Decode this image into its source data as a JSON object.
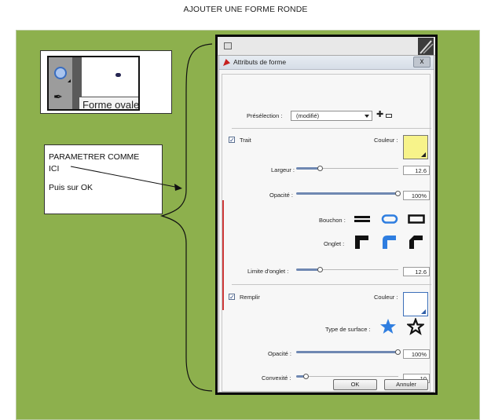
{
  "page": {
    "title": "AJOUTER UNE FORME RONDE"
  },
  "thumbnail": {
    "tooltip": "Forme ovale"
  },
  "note": {
    "line1": "PARAMETRER COMME",
    "line2": "ICI",
    "line3": "Puis sur OK"
  },
  "dialog": {
    "title": "Attributs de forme",
    "close_label": "x",
    "preset": {
      "label": "Présélection :",
      "value": "(modifié)",
      "add_icon": "plus-icon",
      "remove_icon": "minus-icon"
    },
    "stroke": {
      "label": "Trait",
      "checked": true,
      "color_label": "Couleur :",
      "color": "#f7f38a",
      "width_label": "Largeur :",
      "width_value": "12.6",
      "width_fraction": 0.24,
      "opacity_label": "Opacité :",
      "opacity_value": "100%",
      "opacity_fraction": 1.0,
      "cap_label": "Bouchon :",
      "join_label": "Onglet :",
      "miter_label": "Limite d'onglet :",
      "miter_value": "12.6",
      "miter_fraction": 0.24
    },
    "fill": {
      "label": "Remplir",
      "checked": true,
      "color_label": "Couleur :",
      "color": "#ffffff",
      "surface_label": "Type de surface :",
      "opacity_label": "Opacité :",
      "opacity_value": "100%",
      "opacity_fraction": 1.0,
      "convexity_label": "Convexité :",
      "convexity_value": "10",
      "convexity_fraction": 0.1
    },
    "ok_label": "OK",
    "cancel_label": "Annuler",
    "accent": "#2f7ee0"
  }
}
